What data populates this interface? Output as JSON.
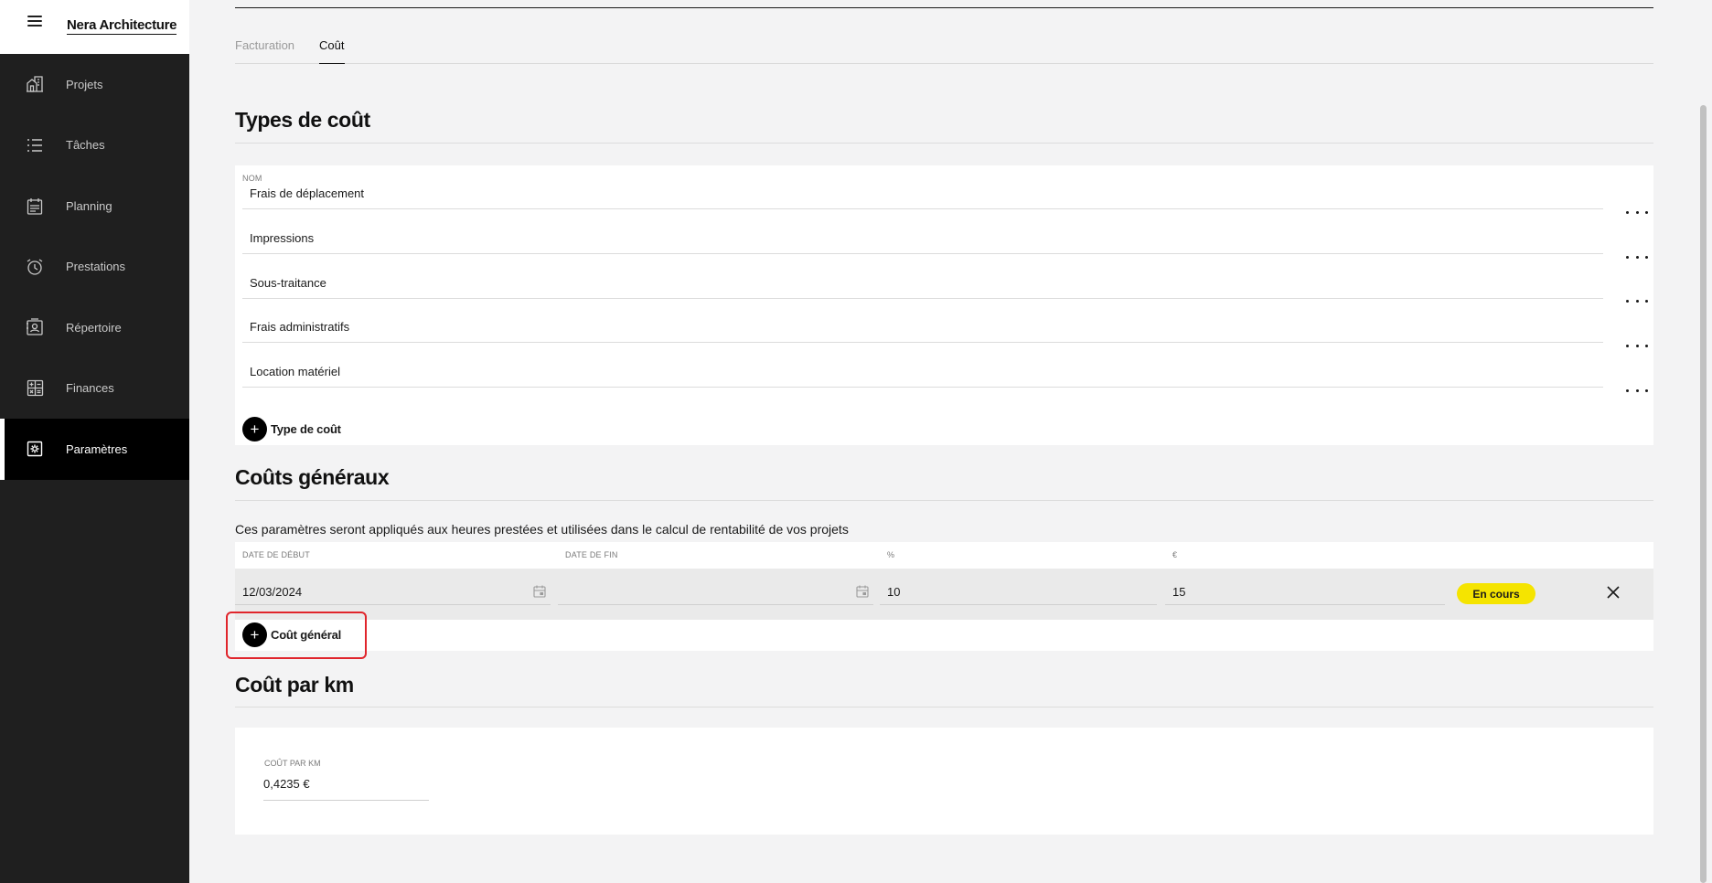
{
  "app": {
    "brand": "Nera Architecture"
  },
  "sidebar": {
    "items": [
      {
        "label": "Projets",
        "icon": "building-icon"
      },
      {
        "label": "Tâches",
        "icon": "list-icon"
      },
      {
        "label": "Planning",
        "icon": "calendar-icon"
      },
      {
        "label": "Prestations",
        "icon": "clock-icon"
      },
      {
        "label": "Répertoire",
        "icon": "contacts-icon"
      },
      {
        "label": "Finances",
        "icon": "calculator-icon"
      },
      {
        "label": "Paramètres",
        "icon": "settings-icon",
        "active": true
      }
    ]
  },
  "tabs": [
    {
      "label": "Facturation",
      "active": false
    },
    {
      "label": "Coût",
      "active": true
    }
  ],
  "types": {
    "title": "Types de coût",
    "column": "Nom",
    "rows": [
      "Frais de déplacement",
      "Impressions",
      "Sous-traitance",
      "Frais administratifs",
      "Location matériel"
    ],
    "add_label": "Type de coût"
  },
  "general": {
    "title": "Coûts généraux",
    "description": "Ces paramètres seront appliqués aux heures prestées et utilisées dans le calcul de rentabilité de vos projets",
    "columns": {
      "start": "Date de début",
      "end": "Date de fin",
      "percent": "%",
      "euro": "€"
    },
    "row": {
      "start": "12/03/2024",
      "end": "",
      "percent": "10",
      "euro": "15",
      "status": "En cours"
    },
    "add_label": "Coût général"
  },
  "km": {
    "title": "Coût par km",
    "label": "Coût par km",
    "value": "0,4235 €"
  },
  "colors": {
    "badge": "#f5e400",
    "sidebar": "#1f1f1f",
    "highlight": "#e0252c"
  }
}
